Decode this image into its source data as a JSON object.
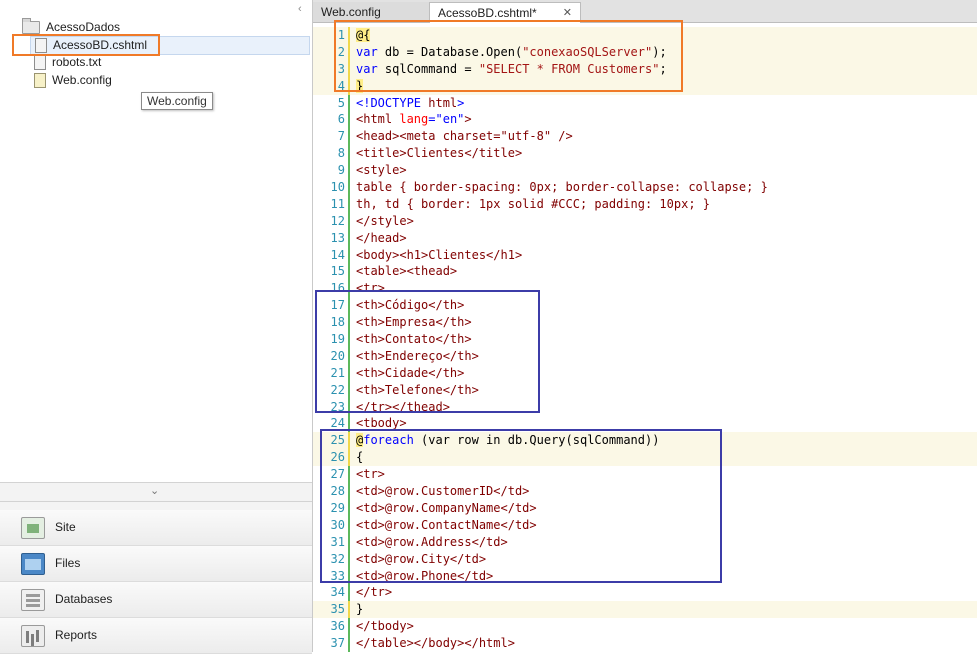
{
  "tree": {
    "folder": "AcessoDados",
    "files": [
      "AcessoBD.cshtml",
      "robots.txt",
      "Web.config"
    ],
    "tooltip": "Web.config"
  },
  "nav": {
    "items": [
      {
        "label": "Site",
        "icon": "site-icon"
      },
      {
        "label": "Files",
        "icon": "files-icon"
      },
      {
        "label": "Databases",
        "icon": "databases-icon"
      },
      {
        "label": "Reports",
        "icon": "reports-icon"
      }
    ]
  },
  "tabs": [
    {
      "label": "Web.config",
      "active": false
    },
    {
      "label": "AcessoBD.cshtml*",
      "active": true,
      "close": "✕"
    }
  ],
  "code": {
    "lines": [
      "1",
      "2",
      "3",
      "4",
      "5",
      "6",
      "7",
      "8",
      "9",
      "10",
      "11",
      "12",
      "13",
      "14",
      "15",
      "16",
      "17",
      "18",
      "19",
      "20",
      "21",
      "22",
      "23",
      "24",
      "25",
      "26",
      "27",
      "28",
      "29",
      "30",
      "31",
      "32",
      "33",
      "34",
      "35",
      "36",
      "37"
    ],
    "text": {
      "l1_at": "@{",
      "l2_kw": "var",
      "l2_rest": " db = Database.Open(",
      "l2_str": "\"conexaoSQLServer\"",
      "l2_end": ");",
      "l3_kw": "var",
      "l3_rest": " sqlCommand = ",
      "l3_str": "\"SELECT * FROM Customers\"",
      "l3_end": ";",
      "l4": "}",
      "l5a": "<!DOCTYPE ",
      "l5b": "html",
      "l5c": ">",
      "l6a": "<html ",
      "l6b": "lang",
      "l6c": "=",
      "l6d": "\"en\"",
      "l6e": ">",
      "l7": "<head><meta charset=\"utf-8\" />",
      "l8": "<title>Clientes</title>",
      "l9": "<style>",
      "l10": "table { border-spacing: 0px; border-collapse: collapse; }",
      "l11": "th, td { border: 1px solid #CCC; padding: 10px; }",
      "l12": "</style>",
      "l13": "</head>",
      "l14": "<body><h1>Clientes</h1>",
      "l15": "<table><thead>",
      "l16": "<tr>",
      "l17": "<th>Código</th>",
      "l18": "<th>Empresa</th>",
      "l19": "<th>Contato</th>",
      "l20": "<th>Endereço</th>",
      "l21": "<th>Cidade</th>",
      "l22": "<th>Telefone</th>",
      "l23": "</tr></thead>",
      "l24": "<tbody>",
      "l25_at": "@",
      "l25_kw": "foreach",
      "l25_rest": " (var row in db.Query(sqlCommand))",
      "l26": "{",
      "l27": "<tr>",
      "l28": "<td>@row.CustomerID</td>",
      "l29": "<td>@row.CompanyName</td>",
      "l30": "<td>@row.ContactName</td>",
      "l31": "<td>@row.Address</td>",
      "l32": "<td>@row.City</td>",
      "l33": "<td>@row.Phone</td>",
      "l34": "</tr>",
      "l35": "}",
      "l36": "</tbody>",
      "l37": "</table></body></html>"
    }
  },
  "colors": {
    "highlight_orange": "#f07a28",
    "highlight_blue": "#3c3ca8",
    "line_number": "#2b91af",
    "html_tag": "#800000",
    "keyword": "#0000ff",
    "string": "#a31515"
  }
}
